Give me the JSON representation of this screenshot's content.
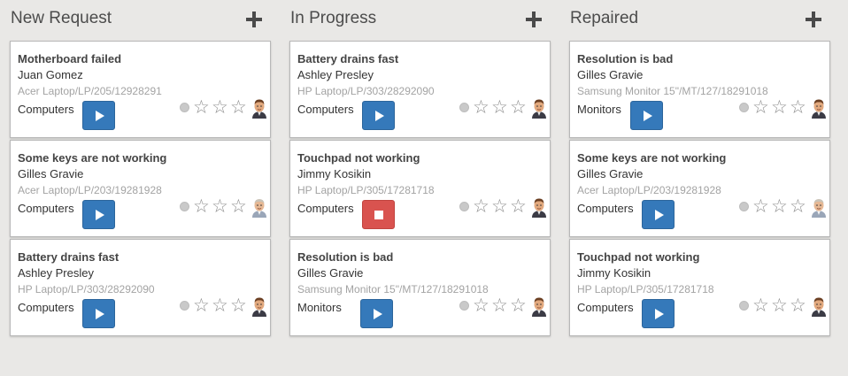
{
  "columns": [
    {
      "title": "New Request",
      "cards": [
        {
          "title": "Motherboard failed",
          "person": "Juan Gomez",
          "device": "Acer Laptop/LP/205/12928291",
          "category": "Computers",
          "action": "play"
        },
        {
          "title": "Some keys are not working",
          "person": "Gilles Gravie",
          "device": "Acer Laptop/LP/203/19281928",
          "category": "Computers",
          "action": "play"
        },
        {
          "title": "Battery drains fast",
          "person": "Ashley Presley",
          "device": "HP Laptop/LP/303/28292090",
          "category": "Computers",
          "action": "play"
        }
      ]
    },
    {
      "title": "In Progress",
      "cards": [
        {
          "title": "Battery drains fast",
          "person": "Ashley Presley",
          "device": "HP Laptop/LP/303/28292090",
          "category": "Computers",
          "action": "play"
        },
        {
          "title": "Touchpad not working",
          "person": "Jimmy Kosikin",
          "device": "HP Laptop/LP/305/17281718",
          "category": "Computers",
          "action": "stop"
        },
        {
          "title": "Resolution is bad",
          "person": "Gilles Gravie",
          "device": "Samsung Monitor 15\"/MT/127/18291018",
          "category": "Monitors",
          "action": "play"
        }
      ]
    },
    {
      "title": "Repaired",
      "cards": [
        {
          "title": "Resolution is bad",
          "person": "Gilles Gravie",
          "device": "Samsung Monitor 15\"/MT/127/18291018",
          "category": "Monitors",
          "action": "play"
        },
        {
          "title": "Some keys are not working",
          "person": "Gilles Gravie",
          "device": "Acer Laptop/LP/203/19281928",
          "category": "Computers",
          "action": "play"
        },
        {
          "title": "Touchpad not working",
          "person": "Jimmy Kosikin",
          "device": "HP Laptop/LP/305/17281718",
          "category": "Computers",
          "action": "play"
        }
      ]
    }
  ],
  "icons": {
    "add": "plus-icon",
    "play": "play-icon",
    "stop": "stop-icon",
    "star": "star-outline-icon",
    "status": "status-dot-icon",
    "avatar": "avatar-icon"
  },
  "colors": {
    "background": "#e9e8e6",
    "play_button": "#3579ba",
    "stop_button": "#d9534f",
    "device_text": "#a3a3a3",
    "star": "#8e8e8e"
  },
  "rating_max": 3,
  "rating_value": 0
}
